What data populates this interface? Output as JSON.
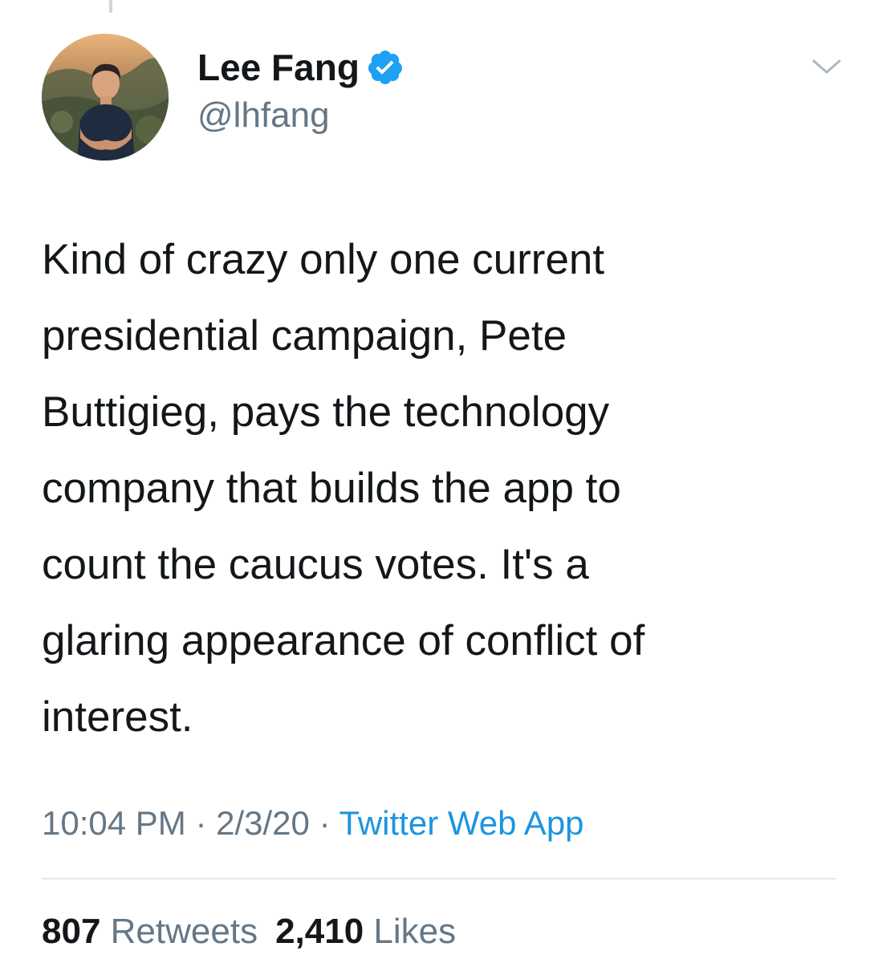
{
  "tweet": {
    "author": {
      "display_name": "Lee Fang",
      "handle": "@lhfang",
      "verified": true,
      "avatar_icon": "profile-photo"
    },
    "text": "Kind of crazy only one current\npresidential campaign, Pete\nButtigieg, pays the technology\ncompany that builds the app to\ncount the caucus votes. It's a\nglaring appearance of conflict of\ninterest.",
    "time": "10:04 PM",
    "separator": "·",
    "date": "2/3/20",
    "source": "Twitter Web App",
    "stats": {
      "retweets_count": "807",
      "retweets_label": "Retweets",
      "likes_count": "2,410",
      "likes_label": "Likes"
    }
  },
  "colors": {
    "text_primary": "#14171a",
    "text_secondary": "#657786",
    "link": "#1b95e0",
    "verified": "#1da1f2",
    "divider": "#e1e8ed"
  },
  "icons": {
    "verified": "verified-badge-icon",
    "menu": "chevron-down-icon"
  }
}
